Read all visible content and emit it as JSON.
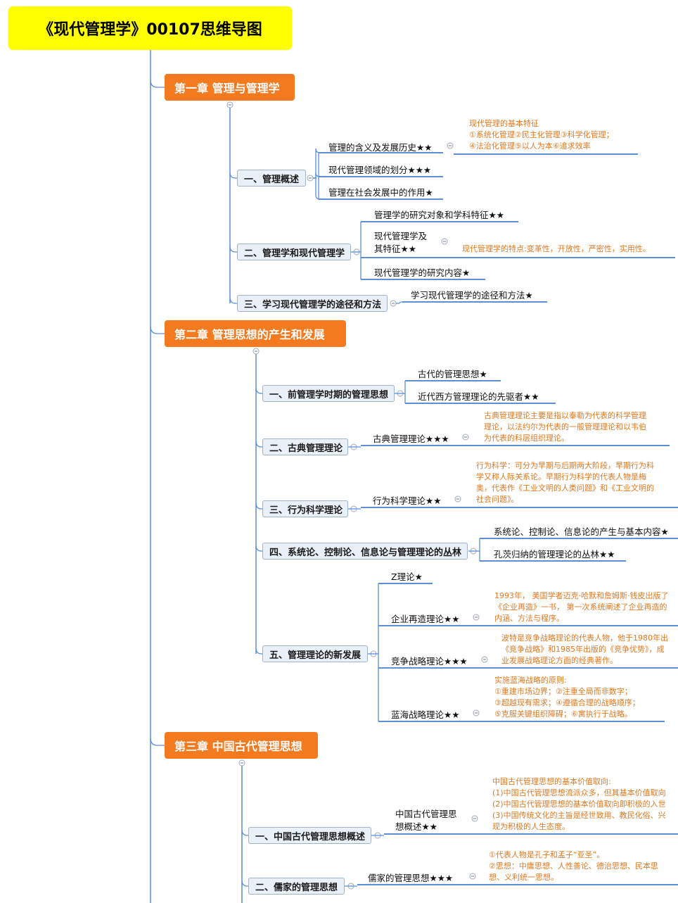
{
  "root": "《现代管理学》00107思维导图",
  "chapters": [
    {
      "title": "第一章 管理与管理学",
      "sections": [
        {
          "title": "一、管理概述",
          "items": [
            {
              "label": "管理的含义及发展历史★★",
              "note": "现代管理的基本特征\n①系统化管理②民主化管理③科学化管理；\n④法治化管理⑤以人为本⑥追求效率"
            },
            {
              "label": "现代管理领域的划分★★★"
            },
            {
              "label": "管理在社会发展中的作用★"
            }
          ]
        },
        {
          "title": "二、管理学和现代管理学",
          "items": [
            {
              "label": "管理学的研究对象和学科特征★★"
            },
            {
              "label": "现代管理学及\n其特征★★",
              "note": "现代管理学的特点:变革性，开放性，严密性，实用性。"
            },
            {
              "label": "现代管理学的研究内容★"
            }
          ]
        },
        {
          "title": "三、学习现代管理学的途径和方法",
          "items": [
            {
              "label": "学习现代管理学的途径和方法★"
            }
          ]
        }
      ]
    },
    {
      "title": "第二章  管理思想的产生和发展",
      "sections": [
        {
          "title": "一、前管理学时期的管理思想",
          "items": [
            {
              "label": "古代的管理思想★"
            },
            {
              "label": "近代西方管理理论的先驱者★★"
            }
          ]
        },
        {
          "title": "二、古典管理理论",
          "items": [
            {
              "label": "古典管理理论★★★",
              "note": "古典管理理论主要是指以泰勒为代表的科学管理\n理论，以法约尔为代表的一般管理理论和以韦伯\n为代表的科层组织理论。"
            }
          ]
        },
        {
          "title": "三、行为科学理论",
          "items": [
            {
              "label": "行为科学理论★★",
              "note": "行为科学：可分为早期与后期两大阶段，早期行为科\n学又称人际关系论。早期行为科学的代表人物是梅\n奥，代表作《工业文明的人类问题》和《工业文明的\n社会问题》。"
            }
          ]
        },
        {
          "title": "四、系统论、控制论、信息论与管理理论的丛林",
          "items": [
            {
              "label": "系统论、控制论、信息论的产生与基本内容★"
            },
            {
              "label": "孔茨归纳的管理理论的丛林★★"
            }
          ]
        },
        {
          "title": "五、管理理论的新发展",
          "items": [
            {
              "label": "Z理论★"
            },
            {
              "label": "企业再造理论★★",
              "note": "1993年， 美国学者迈克·哈默和詹姆斯·钱皮出版了\n《企业再造》一书， 第一次系统阐述了企业再造的\n内涵、方法与程序。"
            },
            {
              "label": "竞争战略理论★★★",
              "note": "波特是竞争战略理论的代表人物，他于1980年出\n《竞争战略》和1985年出版的《竞争优势》，成\n业发展战略理论方面的经典著作。"
            },
            {
              "label": "蓝海战略理论★★",
              "note": "实施蓝海战略的原则:\n①重建市场边界；②注重全局而非数字；\n③超越现有需求；④遵循合理的战略顺序；\n⑤克服关键组织障碍；⑥寓执行于战略。"
            }
          ]
        }
      ]
    },
    {
      "title": "第三章 中国古代管理思想",
      "sections": [
        {
          "title": "一、中国古代管理思想概述",
          "items": [
            {
              "label": "中国古代管理思\n想概述★★",
              "note": "中国古代管理思想的基本价值取向:\n(1)中国古代管理思想流派众多，但其基本价值取向\n(2)中国古代管理思想的基本价值取向即积极的入世\n(3)中国传统文化的主旨是经世致用、教民化俗、兴\n现为积极的人生态度。"
            }
          ]
        },
        {
          "title": "二、儒家的管理思想",
          "items": [
            {
              "label": "儒家的管理思想★★★",
              "note": "①代表人物是孔子和孟子“亚圣”。\n②思想：中庸思想、人性善论、德治思想、民本思\n想、义利统一思想。"
            }
          ]
        }
      ]
    }
  ]
}
